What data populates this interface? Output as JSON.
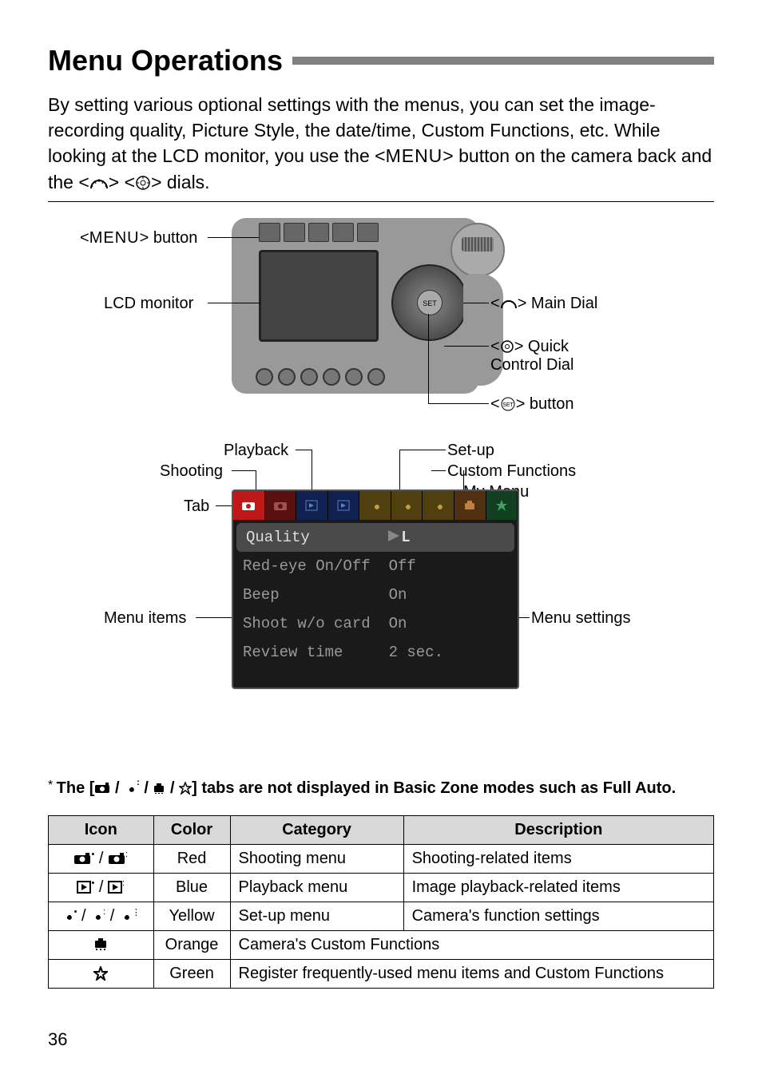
{
  "title": "Menu Operations",
  "intro_parts": {
    "p1": "By setting various optional settings with the menus, you can set the image-recording quality, Picture Style, the date/time, Custom Functions, etc. While looking at the LCD monitor, you use the <",
    "menu_word": "MENU",
    "p2": "> button on the camera back and the <",
    "p3": "> <",
    "p4": "> dials."
  },
  "diagram_labels": {
    "menu_button": "<MENU> button",
    "lcd_monitor": "LCD monitor",
    "main_dial_pre": "<",
    "main_dial_post": "> Main Dial",
    "quick_pre": "<",
    "quick_mid": "> Quick",
    "quick_line2": "Control Dial",
    "set_pre": "<",
    "set_post": "> button",
    "playback": "Playback",
    "shooting": "Shooting",
    "setup": "Set-up",
    "custom": "Custom Functions",
    "mymenu": "My Menu",
    "tab": "Tab",
    "menu_items": "Menu items",
    "menu_settings": "Menu settings"
  },
  "menu_screen": {
    "rows": [
      {
        "left": "Quality",
        "right": ""
      },
      {
        "left": "Red-eye On/Off",
        "right": "Off"
      },
      {
        "left": "Beep",
        "right": "On"
      },
      {
        "left": "Shoot w/o card",
        "right": "On"
      },
      {
        "left": "Review time",
        "right": "2 sec."
      }
    ]
  },
  "footnote": {
    "pre": "* ",
    "text_a": "The [",
    "text_b": "] tabs are not displayed in Basic Zone modes such as Full Auto."
  },
  "table": {
    "headers": [
      "Icon",
      "Color",
      "Category",
      "Description"
    ],
    "rows": [
      {
        "color": "Red",
        "category": "Shooting menu",
        "desc": "Shooting-related items"
      },
      {
        "color": "Blue",
        "category": "Playback menu",
        "desc": "Image playback-related items"
      },
      {
        "color": "Yellow",
        "category": "Set-up menu",
        "desc": "Camera's function settings"
      },
      {
        "color": "Orange",
        "category_span": "Camera's Custom Functions"
      },
      {
        "color": "Green",
        "category_span": "Register frequently-used menu items and Custom Functions"
      }
    ]
  },
  "page_number": "36"
}
